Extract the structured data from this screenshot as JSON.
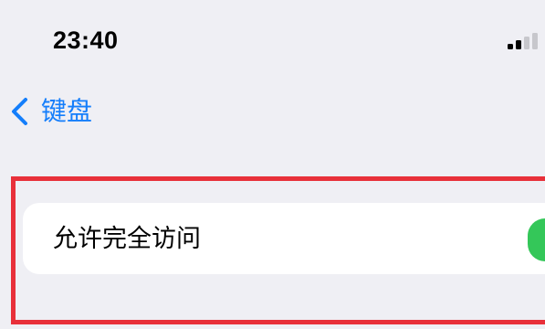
{
  "status_bar": {
    "time": "23:40",
    "signal_icon": "cellular-signal-icon",
    "signal_bars_total": 4,
    "signal_bars_active": 2
  },
  "nav": {
    "back_icon": "chevron-left-icon",
    "back_label": "键盘"
  },
  "settings_row": {
    "label": "允许完全访问",
    "toggle_on": true
  },
  "colors": {
    "accent": "#147efb",
    "toggle_on": "#34c759",
    "highlight": "#e8303a",
    "background": "#efeff4"
  }
}
